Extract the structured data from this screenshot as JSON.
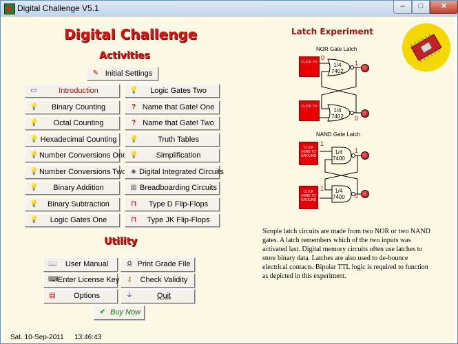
{
  "window": {
    "title": "Digital Challenge V5.1",
    "min": "–",
    "max": "□",
    "close": "✕"
  },
  "app_title": "Digital Challenge",
  "activities_heading": "Activities",
  "initial_settings": "Initial Settings",
  "activities_left": [
    {
      "label": "Introduction",
      "icon": "book-icon"
    },
    {
      "label": "Binary Counting",
      "icon": "bulb-icon"
    },
    {
      "label": "Octal Counting",
      "icon": "bulb-icon"
    },
    {
      "label": "Hexadecimal Counting",
      "icon": "bulb-icon"
    },
    {
      "label": "Number Conversions One",
      "icon": "bulb-icon"
    },
    {
      "label": "Number Conversions Two",
      "icon": "bulb-icon"
    },
    {
      "label": "Binary Addition",
      "icon": "bulb-icon"
    },
    {
      "label": "Binary Subtraction",
      "icon": "bulb-icon"
    },
    {
      "label": "Logic Gates One",
      "icon": "bulb-icon"
    }
  ],
  "activities_right": [
    {
      "label": "Logic Gates Two",
      "icon": "bulb-icon"
    },
    {
      "label": "Name that Gate! One",
      "icon": "question-icon"
    },
    {
      "label": "Name that Gate! Two",
      "icon": "question-icon"
    },
    {
      "label": "Truth Tables",
      "icon": "bulb-icon"
    },
    {
      "label": "Simplification",
      "icon": "bulb-icon"
    },
    {
      "label": "Digital Integrated Circuits",
      "icon": "chip-icon"
    },
    {
      "label": "Breadboarding Circuits",
      "icon": "breadboard-icon"
    },
    {
      "label": "Type D Flip-Flops",
      "icon": "waveform-icon"
    },
    {
      "label": "Type JK Flip-Flops",
      "icon": "waveform-icon"
    }
  ],
  "utility_heading": "Utility",
  "utility": {
    "user_manual": "User Manual",
    "print_grade": "Print Grade File",
    "license": "Enter License Key",
    "validity": "Check Validity",
    "options": "Options",
    "quit": "Quit",
    "buy": "Buy Now"
  },
  "status": {
    "date": "Sat.  10-Sep-2011",
    "time": "13:46:43"
  },
  "latch": {
    "title": "Latch Experiment",
    "nor_label": "NOR Gate Latch",
    "nand_label": "NAND Gate Latch",
    "nor_gate": "1/4\n7402",
    "nand_gate": "1/4\n7400",
    "click_text": "CLICK HERE TO GROUND",
    "nor_input_text": "CLICK TO",
    "nor_top_in": "0",
    "nor_top_out": "1",
    "nor_bot_out": "0",
    "nand_top_in": "1",
    "nand_bot_in": "1",
    "nand_top_out": "1",
    "nand_bot_out": "0",
    "description": "Simple latch circuits are made from two NOR or two NAND gates. A latch remembers which of the two inputs was activated last. Digital memory circuits often use latches to store binary data. Latches are also used to de-bounce electrical contacts. Bipolar TTL logic is required to function as depicted in this experiment."
  }
}
